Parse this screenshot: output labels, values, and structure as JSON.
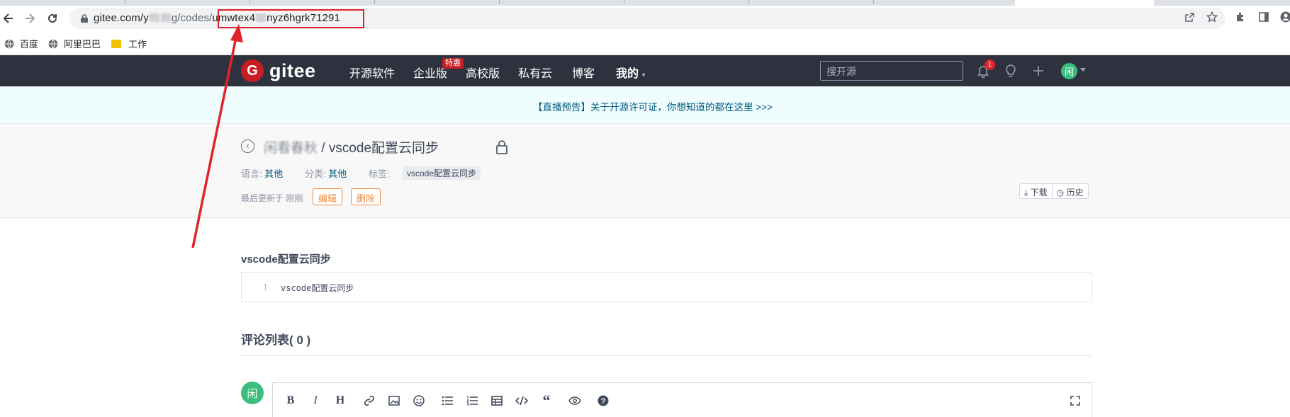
{
  "browser": {
    "url_host": "gitee.com/y",
    "url_mid": "g/codes/",
    "url_code_a": "umwtex4",
    "url_code_b": "nyz6hgrk71291"
  },
  "bookmarks": [
    {
      "label": "百度"
    },
    {
      "label": "阿里巴巴"
    },
    {
      "label": "工作"
    }
  ],
  "header": {
    "logo_text": "gitee",
    "logo_glyph": "G",
    "nav": [
      "开源软件",
      "企业版",
      "高校版",
      "私有云",
      "博客",
      "我的"
    ],
    "promo_badge": "特惠",
    "search_placeholder": "搜开源",
    "notification_count": "1",
    "avatar_text": "闲"
  },
  "announcement": "【直播预告】关于开源许可证，你想知道的都在这里 >>>",
  "repo": {
    "owner_visible": "闲看春秋",
    "title_sep": " / ",
    "snippet_name": "vscode配置云同步",
    "meta": {
      "lang_label": "语言:",
      "lang_value": "其他",
      "cat_label": "分类:",
      "cat_value": "其他",
      "tag_label": "标签:",
      "tag_value": "vscode配置云同步"
    },
    "updated": "最后更新于 刚刚",
    "edit_label": "编辑",
    "delete_label": "删除",
    "download_label": "下载",
    "history_label": "历史"
  },
  "file": {
    "filename": "vscode配置云同步",
    "lines": [
      {
        "no": "1",
        "text": "vscode配置云同步"
      }
    ]
  },
  "comments": {
    "title": "评论列表( 0 )",
    "avatar_text": "闲"
  },
  "editor_tools": [
    "bold-icon",
    "italic-icon",
    "heading-icon",
    "link-icon",
    "image-icon",
    "emoji-icon",
    "bullet-list-icon",
    "numbered-list-icon",
    "table-icon",
    "code-icon",
    "quote-icon",
    "preview-icon",
    "help-icon",
    "fullscreen-icon"
  ],
  "colors": {
    "header_bg": "#2e323e",
    "brand_red": "#c71d23",
    "link_blue": "#005980",
    "orange": "#f0883a",
    "annotation_red": "#e0242b"
  }
}
